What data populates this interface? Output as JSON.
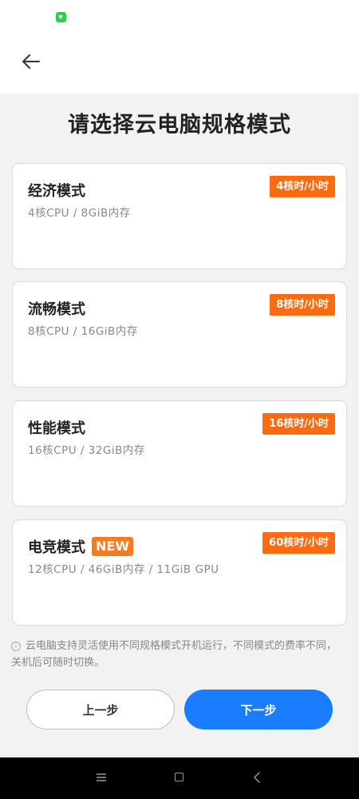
{
  "header": {
    "back_icon": "arrow-left-icon",
    "status_icon": "download-icon",
    "status_icon_color": "#2fcf4f"
  },
  "page": {
    "title": "请选择云电脑规格模式"
  },
  "plans": [
    {
      "name": "经济模式",
      "spec": "4核CPU / 8GiB内存",
      "price": "4核时/小时",
      "badge": ""
    },
    {
      "name": "流畅模式",
      "spec": "8核CPU / 16GiB内存",
      "price": "8核时/小时",
      "badge": ""
    },
    {
      "name": "性能模式",
      "spec": "16核CPU / 32GiB内存",
      "price": "16核时/小时",
      "badge": ""
    },
    {
      "name": "电竞模式",
      "spec": "12核CPU / 46GiB内存 / 11GiB GPU",
      "price": "60核时/小时",
      "badge": "NEW"
    }
  ],
  "note": {
    "icon": "info-icon",
    "text": "云电脑支持灵活使用不同规格模式开机运行，不同模式的费率不同，关机后可随时切换。"
  },
  "buttons": {
    "prev_label": "上一步",
    "next_label": "下一步"
  },
  "colors": {
    "accent": "#1a7dff",
    "price_badge": "#fd6b10",
    "new_badge": "#ff7a1a"
  },
  "navbar": {
    "menu_icon": "menu-icon",
    "home_icon": "home-icon",
    "back_icon": "back-triangle-icon"
  }
}
